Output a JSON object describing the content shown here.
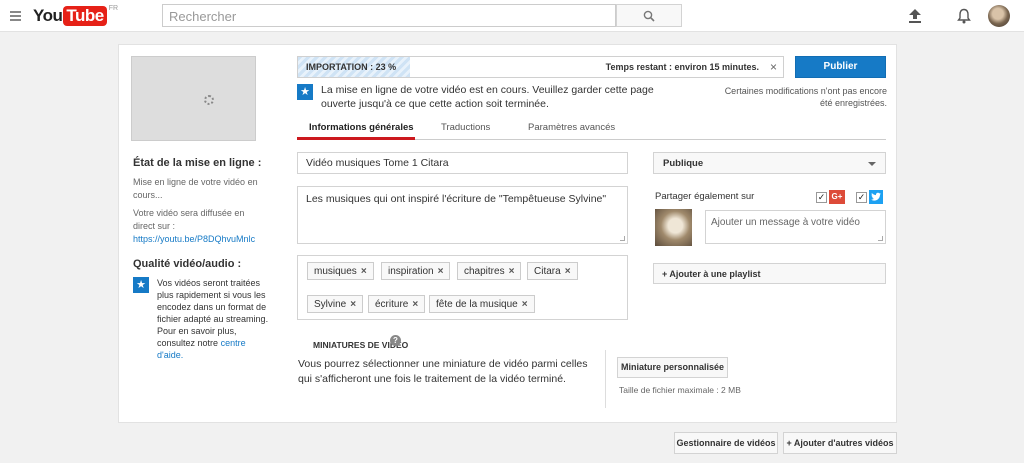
{
  "header": {
    "logo_you": "You",
    "logo_tube": "Tube",
    "logo_region": "FR",
    "search_placeholder": "Rechercher"
  },
  "upload": {
    "progress_label": "IMPORTATION : 23 %",
    "progress_fraction": 0.23,
    "time_left": "Temps restant : environ 15 minutes.",
    "close": "×",
    "publish_label": "Publier",
    "save_note": "Certaines modifications n'ont pas encore été enregistrées.",
    "message": "La mise en ligne de votre vidéo est en cours. Veuillez garder cette page ouverte jusqu'à ce que cette action soit terminée."
  },
  "tabs": [
    {
      "label": "Informations générales",
      "active": true
    },
    {
      "label": "Traductions",
      "active": false
    },
    {
      "label": "Paramètres avancés",
      "active": false
    }
  ],
  "left": {
    "status_title": "État de la mise en ligne :",
    "status_text": "Mise en ligne de votre vidéo en cours...",
    "broadcast_prefix": "Votre vidéo sera diffusée en direct sur :",
    "broadcast_url": "https://youtu.be/P8DQhvuMnlc",
    "quality_title": "Qualité vidéo/audio :",
    "quality_text": "Vos vidéos seront traitées plus rapidement si vous les encodez dans un format de fichier adapté au streaming. Pour en savoir plus, consultez notre",
    "quality_link": "centre d'aide."
  },
  "form": {
    "title_value": "Vidéo musiques Tome 1 Citara",
    "description_value": "Les musiques qui ont inspiré l'écriture de \"Tempêtueuse Sylvine\"",
    "tags": [
      "musiques",
      "inspiration",
      "chapitres",
      "Citara",
      "Sylvine",
      "écriture",
      "fête de la musique"
    ]
  },
  "right": {
    "privacy_value": "Publique",
    "share_label": "Partager également sur",
    "gplus_label": "G+",
    "share_placeholder": "Ajouter un message à votre vidéo",
    "playlist_label": "+ Ajouter à une playlist"
  },
  "thumbnails": {
    "title": "MINIATURES DE VIDÉO",
    "help": "?",
    "text": "Vous pourrez sélectionner une miniature de vidéo parmi celles qui s'afficheront une fois le traitement de la vidéo terminé.",
    "custom_button": "Miniature personnalisée",
    "max_size": "Taille de fichier maximale : 2 MB"
  },
  "footer": {
    "manager_button": "Gestionnaire de vidéos",
    "add_more_button": "+ Ajouter d'autres vidéos"
  },
  "colors": {
    "brand_red": "#e62117",
    "accent_blue": "#167ac6",
    "tab_underline": "#cc181e"
  }
}
